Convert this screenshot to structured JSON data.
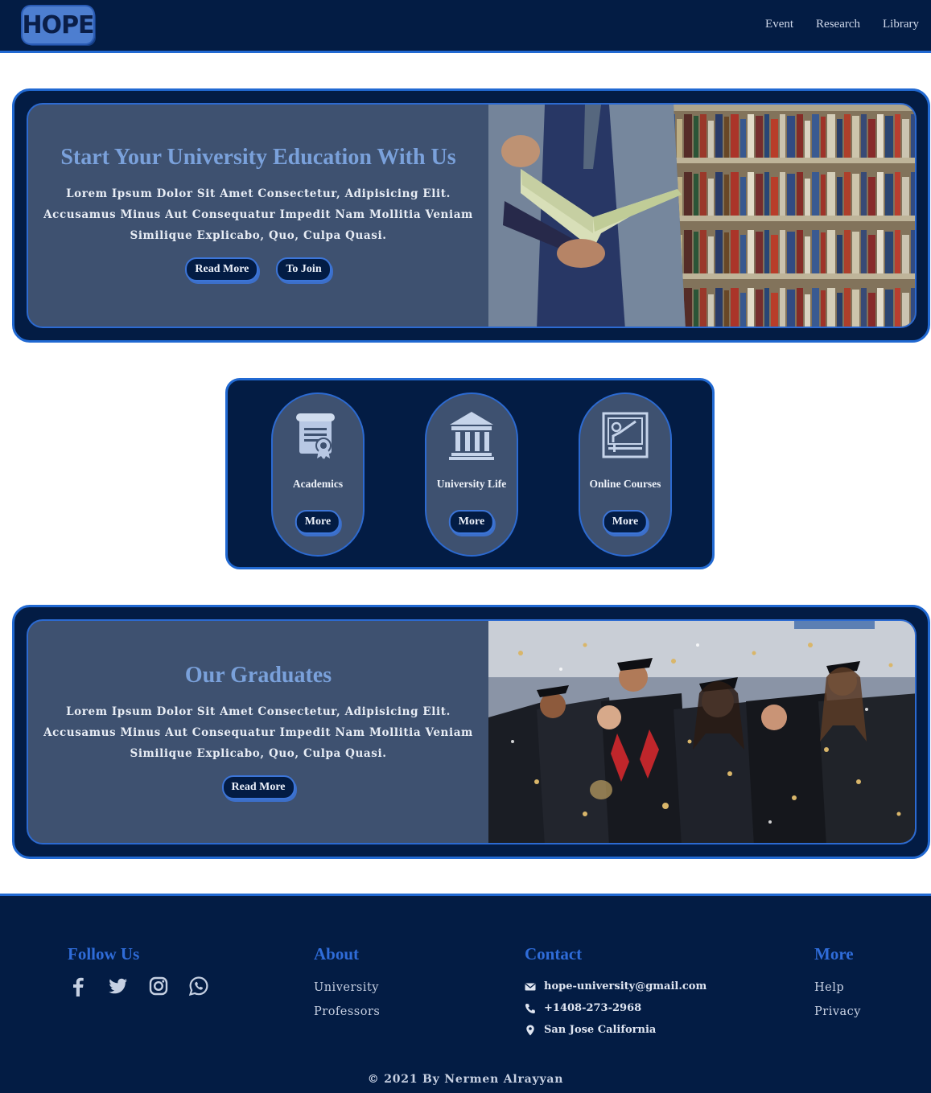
{
  "header": {
    "logo": "HOPE",
    "nav": [
      "Event",
      "Research",
      "Library"
    ]
  },
  "hero": {
    "title": "Start Your University Education With Us",
    "body": "Lorem Ipsum Dolor Sit Amet Consectetur, Adipisicing Elit. Accusamus Minus Aut Consequatur Impedit Nam Mollitia Veniam Similique Explicabo, Quo, Culpa Quasi.",
    "read_more": "Read More",
    "join": "To Join"
  },
  "features": [
    {
      "label": "Academics",
      "button": "More",
      "icon": "diploma-icon"
    },
    {
      "label": "University Life",
      "button": "More",
      "icon": "university-building-icon"
    },
    {
      "label": "Online Courses",
      "button": "More",
      "icon": "online-teaching-icon"
    }
  ],
  "graduates": {
    "title": "Our Graduates",
    "body": "Lorem Ipsum Dolor Sit Amet Consectetur, Adipisicing Elit. Accusamus Minus Aut Consequatur Impedit Nam Mollitia Veniam Similique Explicabo, Quo, Culpa Quasi.",
    "read_more": "Read More"
  },
  "footer": {
    "follow_title": "Follow Us",
    "social_icons": [
      "facebook-icon",
      "twitter-icon",
      "instagram-icon",
      "whatsapp-icon"
    ],
    "about_title": "About",
    "about_links": [
      "University",
      "Professors"
    ],
    "contact_title": "Contact",
    "email": "hope-university@gmail.com",
    "phone": "+1408-273-2968",
    "address": "San Jose California",
    "more_title": "More",
    "more_links": [
      "Help",
      "Privacy"
    ],
    "copyright": "© 2021 By Nermen Alrayyan"
  },
  "colors": {
    "navy": "#031c44",
    "accent_blue": "#2169d2",
    "panel_slate": "#3e5170",
    "title_blue": "#7aa1db"
  }
}
